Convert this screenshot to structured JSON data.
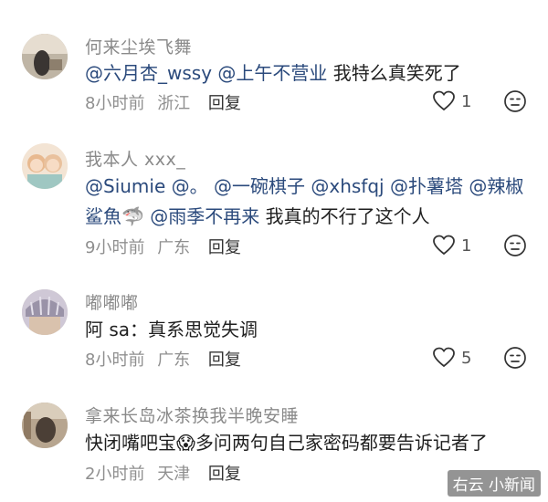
{
  "comments": [
    {
      "username": "何来尘埃飞舞",
      "body": [
        {
          "t": "@六月杏_wssy",
          "m": true
        },
        {
          "t": " ",
          "m": false
        },
        {
          "t": "@上午不营业",
          "m": true
        },
        {
          "t": " 我特么真笑死了",
          "m": false
        }
      ],
      "time": "8小时前",
      "location": "浙江",
      "reply": "回复",
      "likes": "1"
    },
    {
      "username": "我本人 xxx_",
      "body": [
        {
          "t": "@Siumie",
          "m": true
        },
        {
          "t": " ",
          "m": false
        },
        {
          "t": "@。",
          "m": true
        },
        {
          "t": "  ",
          "m": false
        },
        {
          "t": "@一碗棋子",
          "m": true
        },
        {
          "t": " ",
          "m": false
        },
        {
          "t": "@xhsfqj",
          "m": true
        },
        {
          "t": " ",
          "m": false
        },
        {
          "t": "@扑薯塔",
          "m": true
        },
        {
          "t": " ",
          "m": false
        },
        {
          "t": "@辣椒鲨魚",
          "m": true
        },
        {
          "t": "🦈",
          "m": false,
          "emoji": "shark-icon"
        },
        {
          "t": " ",
          "m": false
        },
        {
          "t": "@雨季不再来",
          "m": true
        },
        {
          "t": " 我真的不行了这个人",
          "m": false
        }
      ],
      "time": "9小时前",
      "location": "广东",
      "reply": "回复",
      "likes": "1"
    },
    {
      "username": "嘟嘟嘟",
      "body": [
        {
          "t": "阿 sa：真系思觉失调",
          "m": false
        }
      ],
      "time": "8小时前",
      "location": "广东",
      "reply": "回复",
      "likes": "5"
    },
    {
      "username": "拿来长岛冰茶换我半晚安睡",
      "body": [
        {
          "t": "快闭嘴吧宝",
          "m": false
        },
        {
          "t": "😱",
          "m": false,
          "emoji": "crying-emoji-icon"
        },
        {
          "t": "多问两句自己家密码都要告诉记者了",
          "m": false
        }
      ],
      "time": "2小时前",
      "location": "天津",
      "reply": "回复",
      "likes": ""
    }
  ],
  "watermark": "右云 小新闻"
}
